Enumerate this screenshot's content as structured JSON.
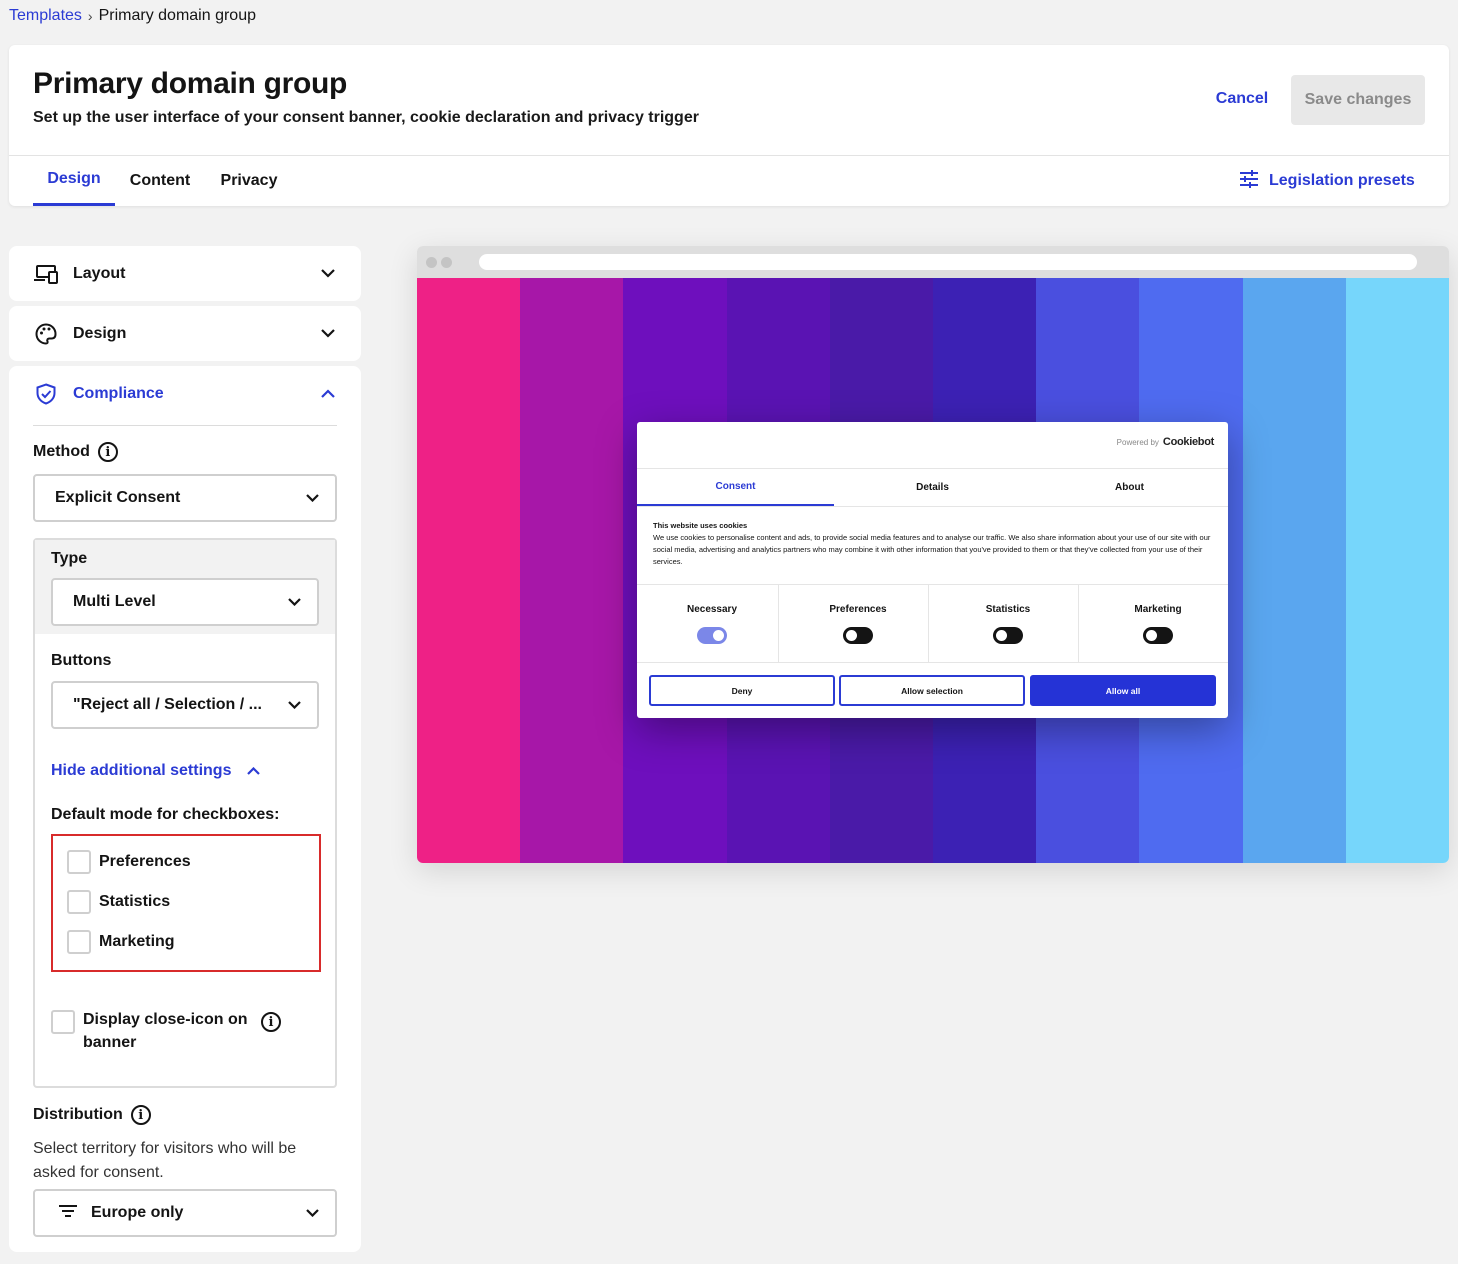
{
  "breadcrumb": {
    "parent": "Templates",
    "separator": "›",
    "current": "Primary domain group"
  },
  "header": {
    "title": "Primary domain group",
    "subtitle": "Set up the user interface of your consent banner, cookie declaration and privacy trigger",
    "cancel_label": "Cancel",
    "save_label": "Save changes"
  },
  "tabs": [
    {
      "label": "Design",
      "active": true
    },
    {
      "label": "Content",
      "active": false
    },
    {
      "label": "Privacy",
      "active": false
    }
  ],
  "legislation_label": "Legislation presets",
  "sidebar": {
    "layout_label": "Layout",
    "design_label": "Design",
    "compliance_label": "Compliance",
    "method": {
      "label": "Method",
      "value": "Explicit Consent"
    },
    "type": {
      "label": "Type",
      "value": "Multi Level"
    },
    "buttons": {
      "label": "Buttons",
      "value": "\"Reject all / Selection / ..."
    },
    "hide_settings_label": "Hide additional settings",
    "default_mode_label": "Default mode for checkboxes:",
    "checkboxes": [
      {
        "label": "Preferences",
        "checked": false
      },
      {
        "label": "Statistics",
        "checked": false
      },
      {
        "label": "Marketing",
        "checked": false
      }
    ],
    "close_icon_label_line1": "Display close-icon on",
    "close_icon_label_line2": "banner",
    "distribution": {
      "label": "Distribution",
      "description_line1": "Select territory for visitors who will be",
      "description_line2": "asked for consent.",
      "value": "Europe only"
    }
  },
  "preview": {
    "stripe_colors": [
      "#ee2186",
      "#a717a8",
      "#6e0fbd",
      "#5a13b3",
      "#4a1aa8",
      "#3c21b4",
      "#4a4fdf",
      "#4f6bf0",
      "#5aa6ef",
      "#76d6fb"
    ],
    "banner": {
      "powered_by": "Powered by",
      "brand": "Cookiebot",
      "tabs": [
        {
          "label": "Consent",
          "active": true
        },
        {
          "label": "Details",
          "active": false
        },
        {
          "label": "About",
          "active": false
        }
      ],
      "heading": "This website uses cookies",
      "body": "We use cookies to personalise content and ads, to provide social media features and to analyse our traffic. We also share information about your use of our site with our social media, advertising and analytics partners who may combine it with other information that you've provided to them or that they've collected from your use of their services.",
      "categories": [
        {
          "label": "Necessary",
          "on": true
        },
        {
          "label": "Preferences",
          "on": false
        },
        {
          "label": "Statistics",
          "on": false
        },
        {
          "label": "Marketing",
          "on": false
        }
      ],
      "buttons": {
        "deny": "Deny",
        "allow_selection": "Allow selection",
        "allow_all": "Allow all"
      }
    }
  }
}
